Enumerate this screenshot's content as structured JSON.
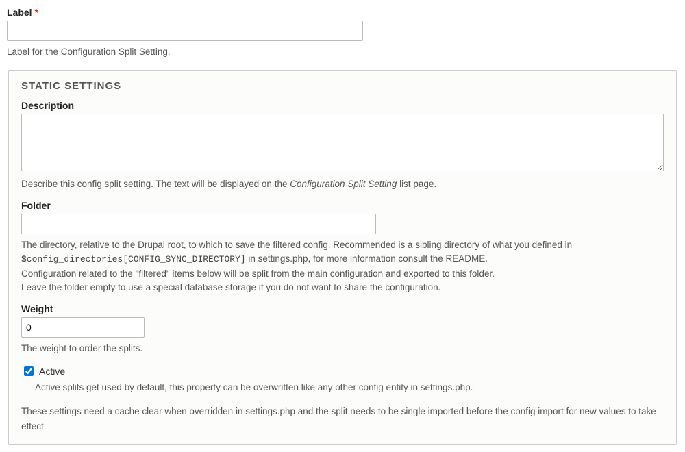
{
  "label": {
    "label_text": "Label",
    "required_marker": "*",
    "value": "",
    "help": "Label for the Configuration Split Setting."
  },
  "static_settings": {
    "legend": "STATIC SETTINGS",
    "description": {
      "label_text": "Description",
      "value": "",
      "help_pre": "Describe this config split setting. The text will be displayed on the ",
      "help_italic": "Configuration Split Setting",
      "help_post": " list page."
    },
    "folder": {
      "label_text": "Folder",
      "value": "",
      "help_line1_pre": "The directory, relative to the Drupal root, to which to save the filtered config. Recommended is a sibling directory of what you defined in ",
      "help_code": "$config_directories[CONFIG_SYNC_DIRECTORY]",
      "help_line1_post": " in settings.php, for more information consult the README.",
      "help_line2": "Configuration related to the \"filtered\" items below will be split from the main configuration and exported to this folder.",
      "help_line3": "Leave the folder empty to use a special database storage if you do not want to share the configuration."
    },
    "weight": {
      "label_text": "Weight",
      "value": "0",
      "help": "The weight to order the splits."
    },
    "active": {
      "label_text": "Active",
      "checked": true,
      "help": "Active splits get used by default, this property can be overwritten like any other config entity in settings.php."
    },
    "note": "These settings need a cache clear when overridden in settings.php and the split needs to be single imported before the config import for new values to take effect."
  }
}
